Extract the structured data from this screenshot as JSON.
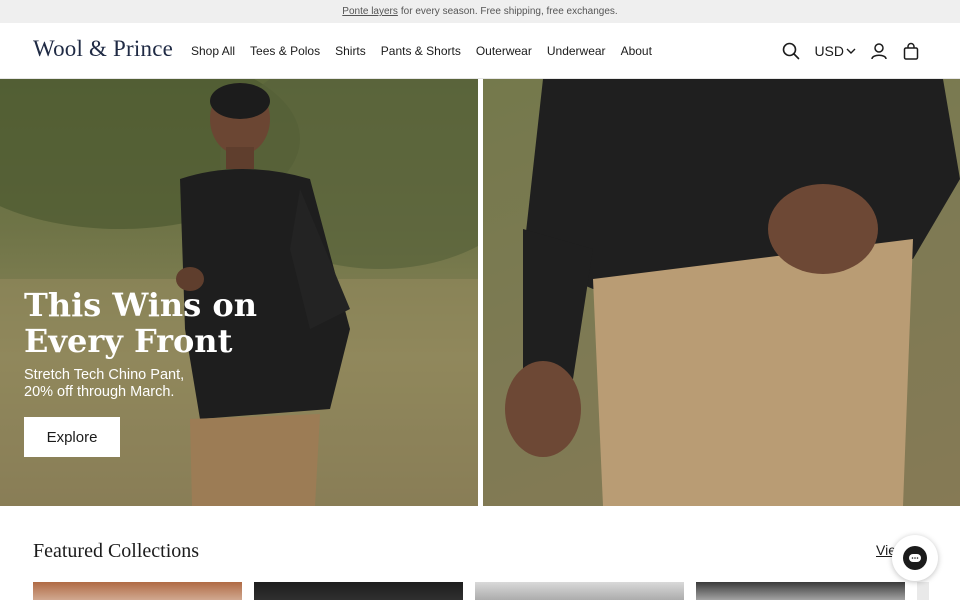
{
  "announcement": {
    "link_text": "Ponte layers",
    "text": "for every season. Free shipping, free exchanges."
  },
  "header": {
    "logo": "Wool & Prince",
    "nav": [
      "Shop All",
      "Tees & Polos",
      "Shirts",
      "Pants & Shorts",
      "Outerwear",
      "Underwear",
      "About"
    ],
    "currency": "USD",
    "icons": [
      "search-icon",
      "chevron-down-icon",
      "account-icon",
      "shopping-bag-icon"
    ]
  },
  "hero": {
    "title_line1": "This Wins on",
    "title_line2": "Every Front",
    "subtitle_line1": "Stretch Tech Chino Pant,",
    "subtitle_line2": "20% off through March.",
    "button": "Explore"
  },
  "featured": {
    "title": "Featured Collections",
    "view_link": "Vie"
  },
  "chat": {
    "icon": "chat-icon"
  },
  "colors": {
    "logo": "#1f2a44",
    "announcement_bg": "#efefef",
    "button_bg": "#ffffff"
  }
}
